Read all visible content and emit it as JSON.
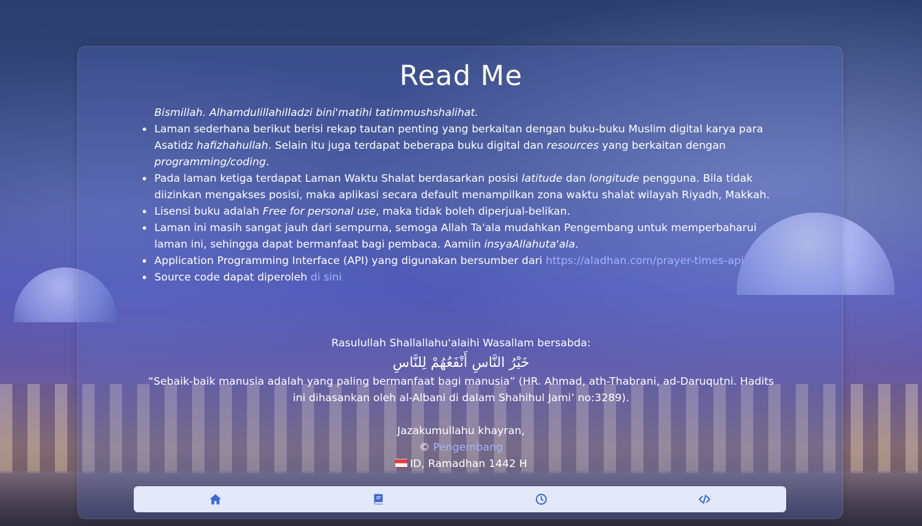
{
  "page": {
    "title": "Read Me"
  },
  "readme": {
    "intro": "Bismillah. Alhamdulillahilladzi bini'matihi tatimmushshalihat.",
    "points": [
      {
        "a": "Laman sederhana berikut berisi rekap tautan penting yang berkaitan dengan buku-buku Muslim digital karya para Asatidz ",
        "b": "hafizhahullah",
        "c": ". Selain itu juga terdapat beberapa buku digital dan ",
        "d": "resources",
        "e": " yang berkaitan dengan ",
        "f": "programming/coding",
        "g": "."
      },
      {
        "a": "Pada laman ketiga terdapat Laman Waktu Shalat berdasarkan posisi ",
        "b": "latitude",
        "c": " dan ",
        "d": "longitude",
        "e": " pengguna. Bila tidak diizinkan mengakses posisi, maka aplikasi secara default menampilkan zona waktu shalat wilayah Riyadh, Makkah."
      },
      {
        "a": "Lisensi buku adalah ",
        "b": "Free for personal use",
        "c": ", maka tidak boleh diperjual-belikan."
      },
      {
        "a": "Laman ini masih sangat jauh dari sempurna, semoga Allah Ta'ala mudahkan Pengembang untuk memperbaharui laman ini, sehingga dapat bermanfaat bagi pembaca. Aamiin ",
        "b": "insyaAllahuta'ala",
        "c": "."
      },
      {
        "a": "Application Programming Interface (API) yang digunakan bersumber dari ",
        "link": "https://aladhan.com/prayer-times-api"
      },
      {
        "a": "Source code dapat diperoleh ",
        "link": "di sini"
      }
    ]
  },
  "hadith": {
    "intro": "Rasulullah Shallallahu'alaihi Wasallam bersabda:",
    "arabic": "خَيْرُ النَّاسِ أَنْفَعُهُمْ لِلنَّاسِ",
    "translation": "“Sebaik-baik manusia adalah yang paling bermanfaat bagi manusia” (HR. Ahmad, ath-Thabrani, ad-Daruqutni. Hadits ini dihasankan oleh al-Albani di dalam Shahihul Jami’ no:3289).",
    "closing": "Jazakumullahu khayran,",
    "copyright_symbol": "©",
    "developer_link": "Pengembang",
    "country_code": "ID",
    "date": ", Ramadhan 1442 H"
  },
  "nav": {
    "items": [
      {
        "icon": "home-icon"
      },
      {
        "icon": "book-icon"
      },
      {
        "icon": "clock-icon"
      },
      {
        "icon": "code-icon"
      }
    ],
    "color": "#3d67d6",
    "background": "#e4e8fb"
  },
  "colors": {
    "link": "#9fb4ff",
    "text": "#ffffff"
  }
}
